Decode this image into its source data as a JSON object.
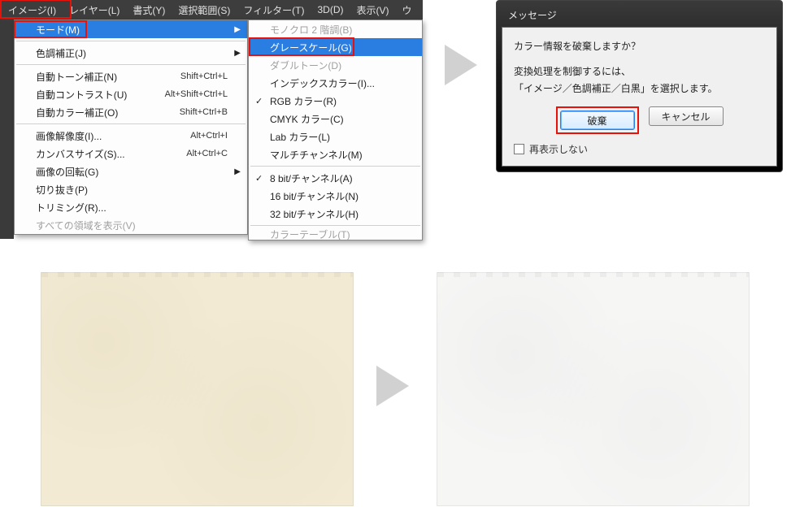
{
  "menubar": {
    "items": [
      "イメージ(I)",
      "レイヤー(L)",
      "書式(Y)",
      "選択範囲(S)",
      "フィルター(T)",
      "3D(D)",
      "表示(V)",
      "ウ"
    ]
  },
  "menu_image": {
    "mode": {
      "label": "モード(M)"
    },
    "adjust": {
      "label": "色調補正(J)"
    },
    "auto_tone": {
      "label": "自動トーン補正(N)",
      "shortcut": "Shift+Ctrl+L"
    },
    "auto_contrast": {
      "label": "自動コントラスト(U)",
      "shortcut": "Alt+Shift+Ctrl+L"
    },
    "auto_color": {
      "label": "自動カラー補正(O)",
      "shortcut": "Shift+Ctrl+B"
    },
    "image_size": {
      "label": "画像解像度(I)...",
      "shortcut": "Alt+Ctrl+I"
    },
    "canvas_size": {
      "label": "カンバスサイズ(S)...",
      "shortcut": "Alt+Ctrl+C"
    },
    "image_rotation": {
      "label": "画像の回転(G)"
    },
    "crop": {
      "label": "切り抜き(P)"
    },
    "trim": {
      "label": "トリミング(R)..."
    },
    "show_all": {
      "label": "すべての領域を表示(V)"
    }
  },
  "menu_mode": {
    "bitmap": {
      "label": "モノクロ 2 階調(B)"
    },
    "grayscale": {
      "label": "グレースケール(G)"
    },
    "duotone": {
      "label": "ダブルトーン(D)"
    },
    "indexed": {
      "label": "インデックスカラー(I)..."
    },
    "rgb": {
      "label": "RGB カラー(R)"
    },
    "cmyk": {
      "label": "CMYK カラー(C)"
    },
    "lab": {
      "label": "Lab カラー(L)"
    },
    "multichannel": {
      "label": "マルチチャンネル(M)"
    },
    "bit8": {
      "label": "8 bit/チャンネル(A)"
    },
    "bit16": {
      "label": "16 bit/チャンネル(N)"
    },
    "bit32": {
      "label": "32 bit/チャンネル(H)"
    },
    "color_table": {
      "label": "カラーテーブル(T)"
    }
  },
  "dialog": {
    "title": "メッセージ",
    "line1": "カラー情報を破棄しますか？",
    "line2": "変換処理を制御するには、",
    "line3": "「イメージ／色調補正／白黒」を選択します。",
    "discard": "破棄",
    "cancel": "キャンセル",
    "dont_show": "再表示しない"
  },
  "icons": {
    "submenu": "▶",
    "check": "✓"
  }
}
